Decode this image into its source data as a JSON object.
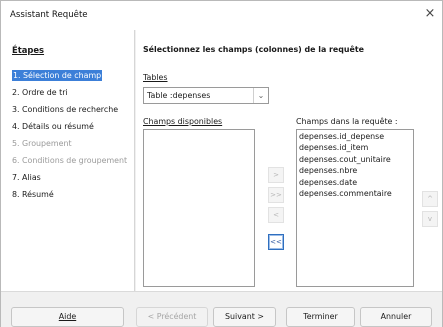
{
  "window": {
    "title": "Assistant Requête",
    "close_icon": "×"
  },
  "steps": {
    "title": "Étapes",
    "items": [
      {
        "label": "1. Sélection de champ",
        "state": "active"
      },
      {
        "label": "2. Ordre de tri",
        "state": "normal"
      },
      {
        "label": "3. Conditions de recherche",
        "state": "normal"
      },
      {
        "label": "4. Détails ou résumé",
        "state": "normal"
      },
      {
        "label": "5. Groupement",
        "state": "disabled"
      },
      {
        "label": "6. Conditions de groupement",
        "state": "disabled"
      },
      {
        "label": "7. Alias",
        "state": "normal"
      },
      {
        "label": "8. Résumé",
        "state": "normal"
      }
    ]
  },
  "main": {
    "title": "Sélectionnez les champs (colonnes) de la requête",
    "tables_label": "Tables",
    "tables_value": "Table :depenses",
    "available_label": "Champs disponibles",
    "query_fields_label": "Champs dans la requête :",
    "query_fields": [
      "depenses.id_depense",
      "depenses.id_item",
      "depenses.cout_unitaire",
      "depenses.nbre",
      "depenses.date",
      "depenses.commentaire"
    ],
    "move_buttons": {
      "add": ">",
      "add_all": ">>",
      "remove": "<",
      "remove_all": "<<"
    },
    "order_buttons": {
      "up": "^",
      "down": "v"
    }
  },
  "footer": {
    "help": "Aide",
    "back": "< Précédent",
    "next": "Suivant >",
    "finish": "Terminer",
    "cancel": "Annuler"
  },
  "colors": {
    "accent": "#3c7fd8",
    "focus_border": "#2f6fbf"
  }
}
